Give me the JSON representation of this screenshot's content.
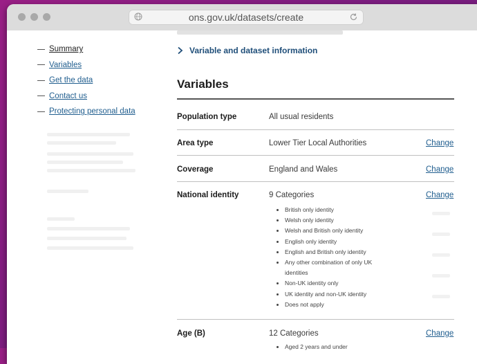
{
  "browser": {
    "url": "ons.gov.uk/datasets/create"
  },
  "nav": {
    "items": [
      {
        "label": "Summary"
      },
      {
        "label": "Variables"
      },
      {
        "label": "Get the data"
      },
      {
        "label": "Contact us"
      },
      {
        "label": "Protecting personal data"
      }
    ]
  },
  "main": {
    "expander_label": "Variable and dataset information",
    "section_title": "Variables",
    "rows": [
      {
        "label": "Population type",
        "value": "All usual residents"
      },
      {
        "label": "Area type",
        "value": "Lower Tier Local Authorities",
        "change": "Change"
      },
      {
        "label": "Coverage",
        "value": "England and Wales",
        "change": "Change"
      },
      {
        "label": "National identity",
        "value": "9 Categories",
        "change": "Change",
        "categories": [
          "British only identity",
          "Welsh only identity",
          "Welsh and British only identity",
          "English only identity",
          "English and British only identity",
          "Any other combination of only UK identities",
          "Non-UK identity only",
          "UK identity and non-UK identity",
          "Does not apply"
        ]
      },
      {
        "label": "Age (B)",
        "value": "12 Categories",
        "change": "Change",
        "categories": [
          "Aged 2 years and under"
        ]
      }
    ]
  }
}
